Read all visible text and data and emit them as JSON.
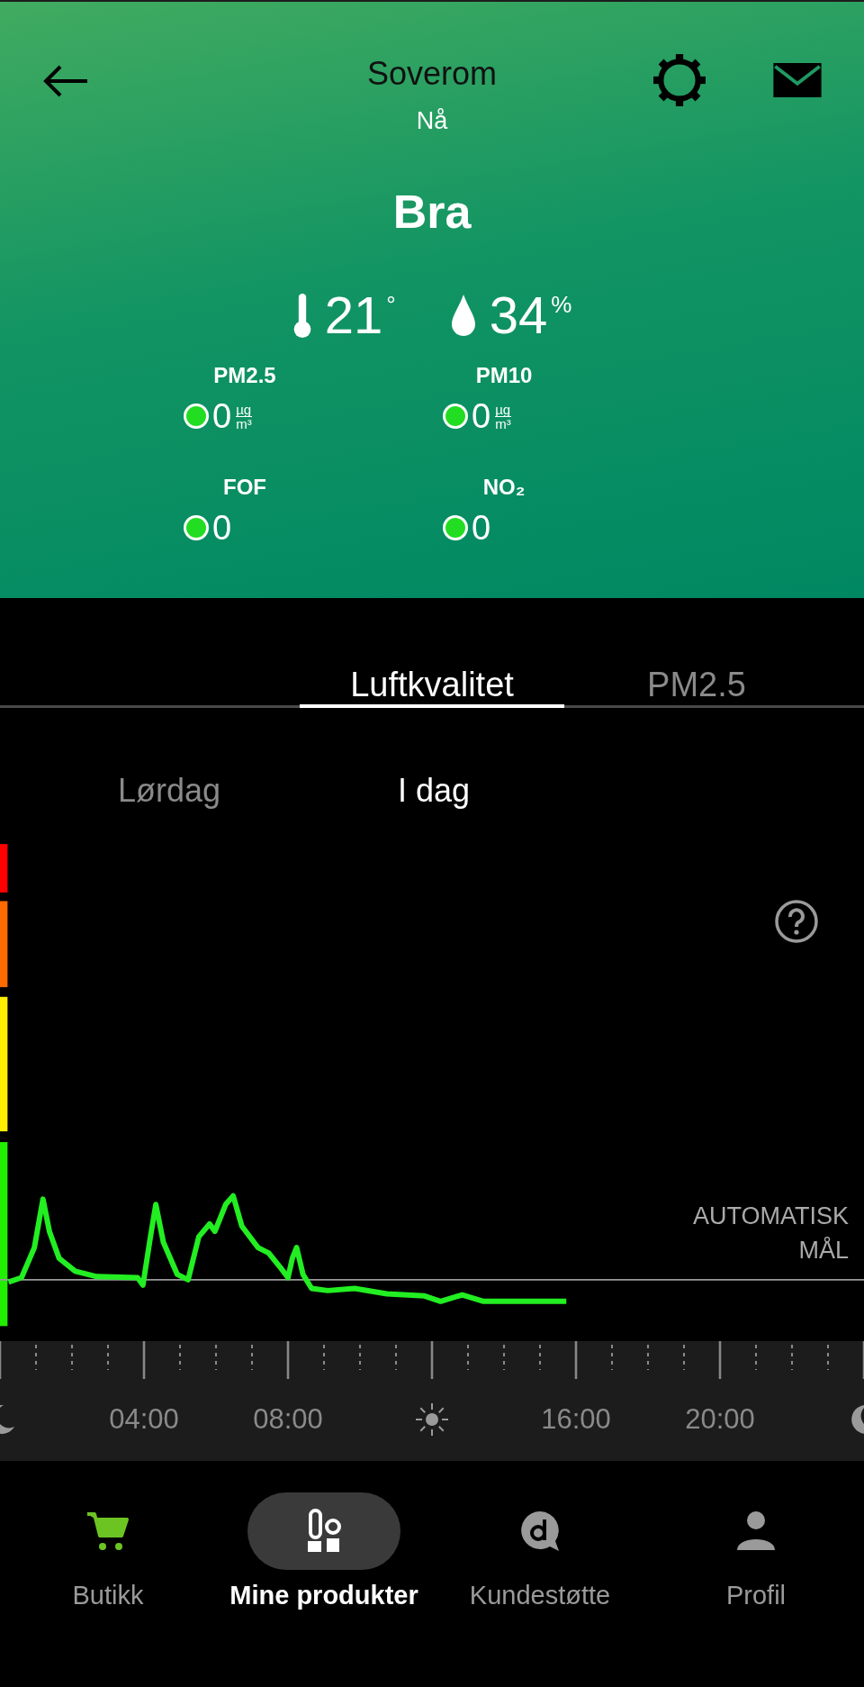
{
  "header": {
    "title": "Soverom",
    "subtitle": "Nå",
    "status": "Bra",
    "readings": [
      {
        "kind": "temperature",
        "value": "21",
        "unit": "°"
      },
      {
        "kind": "humidity",
        "value": "34",
        "unit": "%"
      }
    ],
    "sensors": [
      {
        "label": "PM2.5",
        "value": "0",
        "unit_top": "µg",
        "unit_bottom": "m³",
        "color": "#22dd22"
      },
      {
        "label": "PM10",
        "value": "0",
        "unit_top": "µg",
        "unit_bottom": "m³",
        "color": "#22dd22"
      },
      {
        "label": "FOF",
        "value": "0",
        "color": "#22dd22"
      },
      {
        "label": "NO₂",
        "value": "0",
        "color": "#22dd22"
      }
    ]
  },
  "tabs": [
    {
      "label": "Luftkvalitet",
      "selected": true
    },
    {
      "label": "PM2.5",
      "selected": false
    }
  ],
  "days": [
    {
      "label": "Lørdag",
      "selected": false
    },
    {
      "label": "I dag",
      "selected": true
    }
  ],
  "chart": {
    "target_label_lines": [
      "AUTOMATISK",
      "MÅL"
    ]
  },
  "timeline": [
    {
      "kind": "moon"
    },
    {
      "kind": "time",
      "label": "04:00"
    },
    {
      "kind": "time",
      "label": "08:00"
    },
    {
      "kind": "sun"
    },
    {
      "kind": "time",
      "label": "16:00"
    },
    {
      "kind": "time",
      "label": "20:00"
    },
    {
      "kind": "moon"
    }
  ],
  "nav": [
    {
      "kind": "cart",
      "label": "Butikk",
      "selected": false
    },
    {
      "kind": "products",
      "label": "Mine produkter",
      "selected": true
    },
    {
      "kind": "support",
      "label": "Kundestøtte",
      "selected": false
    },
    {
      "kind": "profile",
      "label": "Profil",
      "selected": false
    }
  ]
}
